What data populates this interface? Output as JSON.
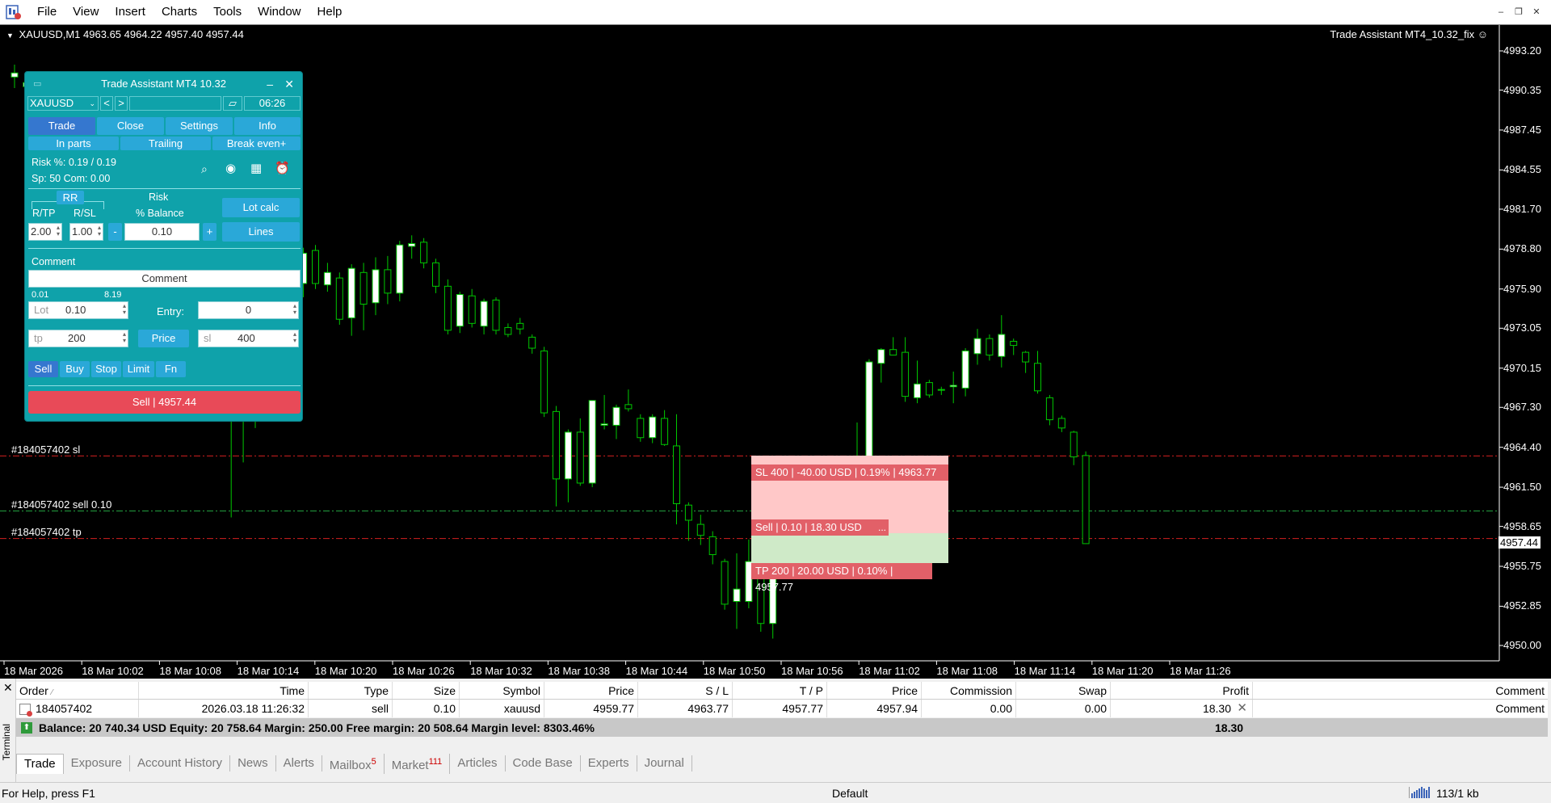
{
  "menu": [
    "File",
    "View",
    "Insert",
    "Charts",
    "Tools",
    "Window",
    "Help"
  ],
  "window_controls": [
    "–",
    "❐",
    "✕"
  ],
  "chart": {
    "symbol_header": "XAUUSD,M1",
    "ohlc": "4963.65 4964.22 4957.40 4957.44",
    "ea_label": "Trade Assistant MT4_10.32_fix",
    "price_ticks": [
      "4993.20",
      "4990.35",
      "4987.45",
      "4984.55",
      "4981.70",
      "4978.80",
      "4975.90",
      "4973.05",
      "4970.15",
      "4967.30",
      "4964.40",
      "4961.50",
      "4958.65",
      "4955.75",
      "4952.85",
      "4950.00"
    ],
    "time_ticks": [
      "18 Mar 2026",
      "18 Mar 10:02",
      "18 Mar 10:08",
      "18 Mar 10:14",
      "18 Mar 10:20",
      "18 Mar 10:26",
      "18 Mar 10:32",
      "18 Mar 10:38",
      "18 Mar 10:44",
      "18 Mar 10:50",
      "18 Mar 10:56",
      "18 Mar 11:02",
      "18 Mar 11:08",
      "18 Mar 11:14",
      "18 Mar 11:20",
      "18 Mar 11:26"
    ],
    "current_price": "4957.44",
    "sl_price": 4963.77,
    "entry_price": 4959.77,
    "tp_price": 4957.77,
    "order_lines": {
      "sl": "#184057402 sl",
      "entry": "#184057402 sell 0.10",
      "tp": "#184057402 tp"
    },
    "zone_labels": {
      "sl": "SL 400 | -40.00 USD | 0.19% | 4963.77",
      "entry": "Sell | 0.10 | 18.30 USD",
      "entry_more": "...",
      "tp": "TP 200 | 20.00 USD | 0.10% | 4957.77"
    }
  },
  "trade_assistant": {
    "title": "Trade Assistant MT4 10.32",
    "symbol": "XAUUSD",
    "time": "06:26",
    "tabs": [
      "Trade",
      "Close",
      "Settings",
      "Info"
    ],
    "subtabs": [
      "In parts",
      "Trailing",
      "Break even+"
    ],
    "risk_text": "Risk %: 0.19 /  0.19",
    "spread_text": "Sp: 50  Com: 0.00",
    "rr_label": "RR",
    "rtp_label": "R/TP",
    "rsl_label": "R/SL",
    "risk_label": "Risk",
    "balance_label": "% Balance",
    "rtp_value": "2.00",
    "rsl_value": "1.00",
    "minus": "-",
    "plus": "+",
    "risk_value": "0.10",
    "lot_calc": "Lot calc",
    "lines": "Lines",
    "comment_label": "Comment",
    "comment_value": "Comment",
    "lot_min": "0.01",
    "lot_max": "8.19",
    "lot_label": "Lot",
    "lot_value": "0.10",
    "entry_label": "Entry:",
    "entry_value": "0",
    "tp_label": "tp",
    "tp_value": "200",
    "price_btn": "Price",
    "sl_label": "sl",
    "sl_value": "400",
    "order_types": [
      "Sell",
      "Buy",
      "Stop",
      "Limit",
      "Fn"
    ],
    "action_button": "Sell  | 4957.44"
  },
  "terminal": {
    "side_label": "Terminal",
    "columns": [
      "Order",
      "Time",
      "Type",
      "Size",
      "Symbol",
      "Price",
      "S / L",
      "T / P",
      "Price",
      "Commission",
      "Swap",
      "Profit",
      "Comment"
    ],
    "order_row": {
      "order": "184057402",
      "time": "2026.03.18 11:26:32",
      "type": "sell",
      "size": "0.10",
      "symbol": "xauusd",
      "open_price": "4959.77",
      "sl": "4963.77",
      "tp": "4957.77",
      "price": "4957.94",
      "commission": "0.00",
      "swap": "0.00",
      "profit": "18.30",
      "comment": "Comment"
    },
    "balance_text": "Balance: 20 740.34 USD  Equity: 20 758.64  Margin: 250.00  Free margin: 20 508.64  Margin level: 8303.46%",
    "balance_profit": "18.30",
    "tabs": [
      {
        "label": "Trade",
        "badge": ""
      },
      {
        "label": "Exposure",
        "badge": ""
      },
      {
        "label": "Account History",
        "badge": ""
      },
      {
        "label": "News",
        "badge": ""
      },
      {
        "label": "Alerts",
        "badge": ""
      },
      {
        "label": "Mailbox",
        "badge": "5"
      },
      {
        "label": "Market",
        "badge": "111"
      },
      {
        "label": "Articles",
        "badge": ""
      },
      {
        "label": "Code Base",
        "badge": ""
      },
      {
        "label": "Experts",
        "badge": ""
      },
      {
        "label": "Journal",
        "badge": ""
      }
    ]
  },
  "status": {
    "help": "For Help, press F1",
    "profile": "Default",
    "traffic": "113/1 kb"
  },
  "colors": {
    "panel": "#0fa2aa",
    "sl_zone": "#ffc8c8",
    "tp_zone": "#cfeac8",
    "label_red": "#e26068",
    "bull_candle": "#ffffff",
    "bear_candle": "#000000",
    "wick": "#00c800"
  }
}
